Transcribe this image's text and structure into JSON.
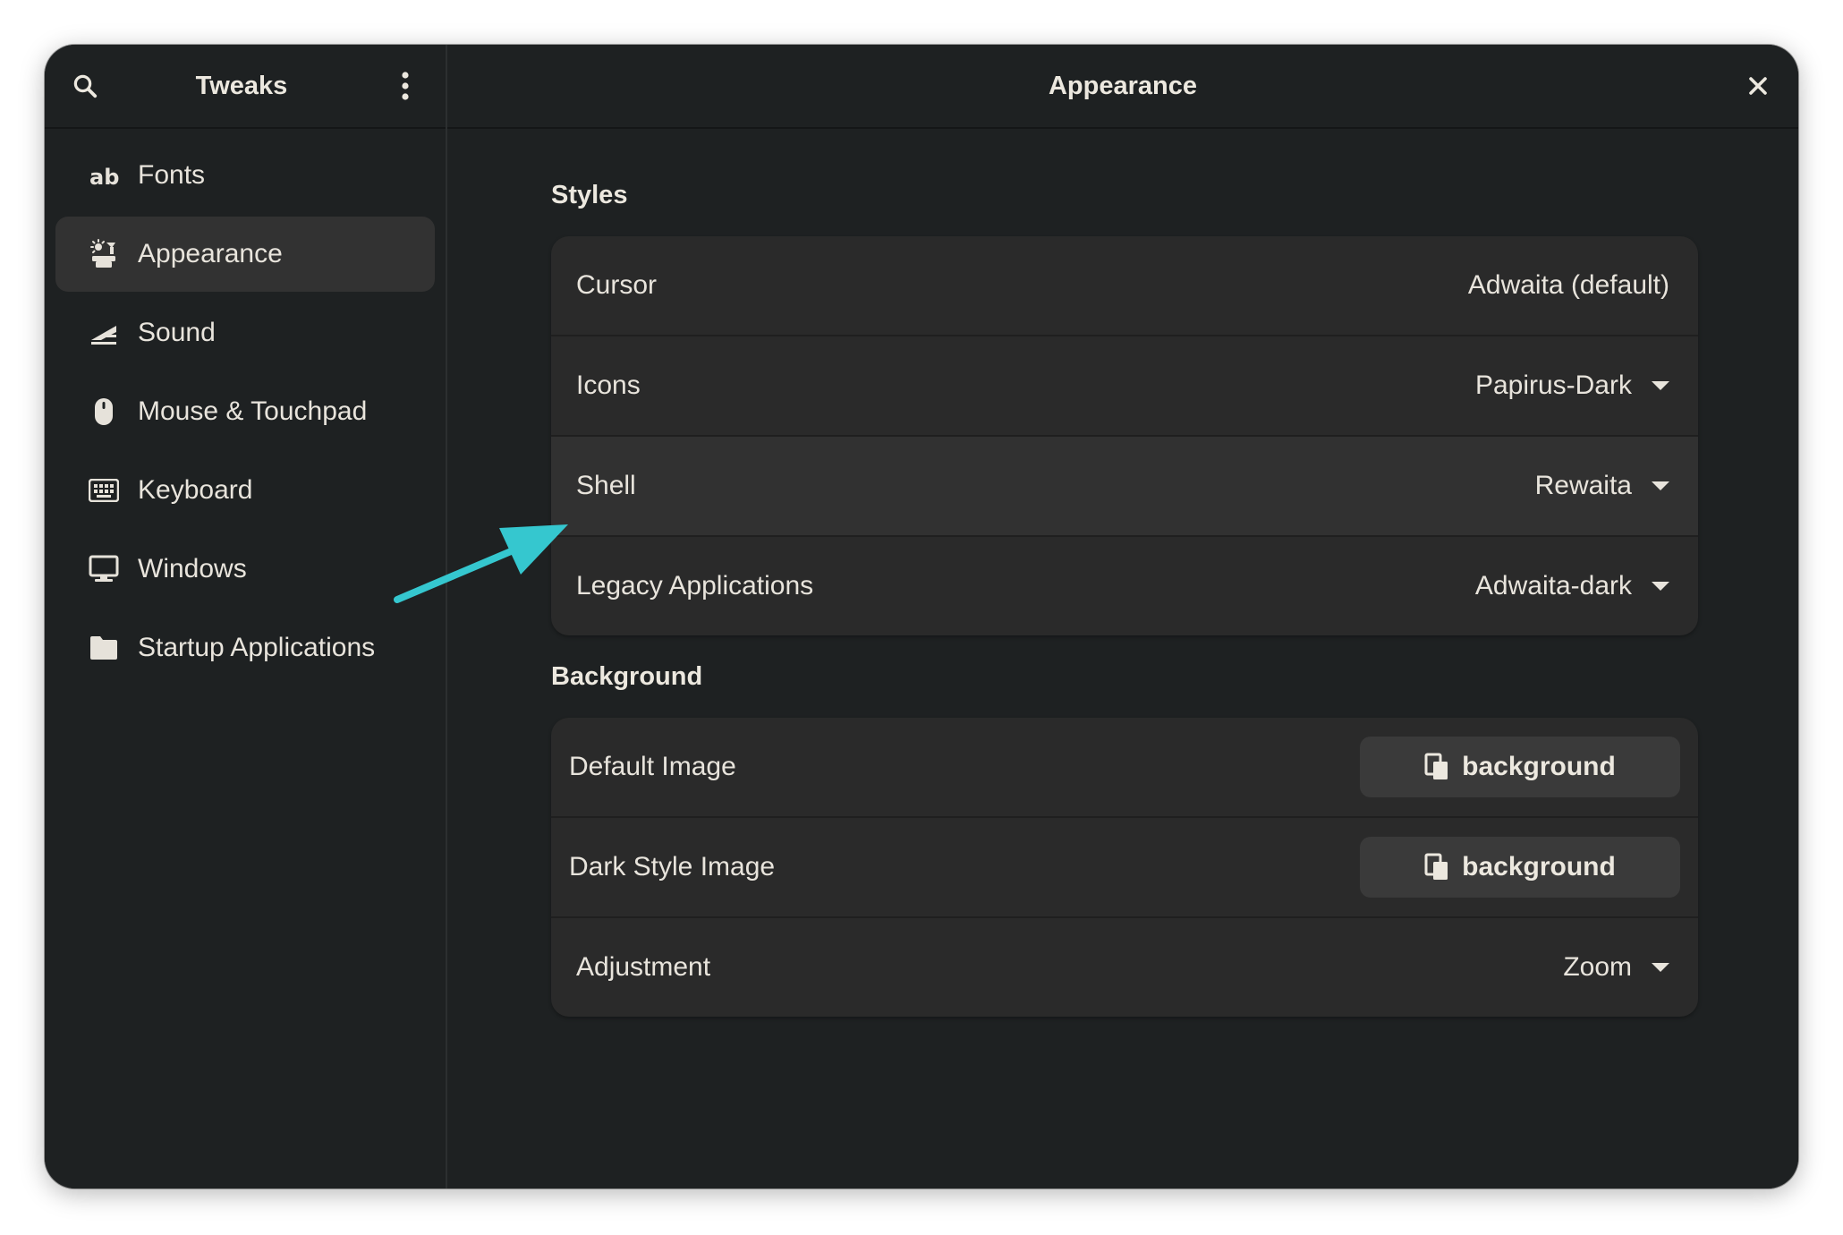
{
  "sidebar": {
    "title": "Tweaks",
    "search_icon": "search-icon",
    "menu_icon": "kebab-menu-icon",
    "items": [
      {
        "label": "Fonts",
        "icon": "fonts-icon",
        "active": false
      },
      {
        "label": "Appearance",
        "icon": "appearance-icon",
        "active": true
      },
      {
        "label": "Sound",
        "icon": "sound-icon",
        "active": false
      },
      {
        "label": "Mouse & Touchpad",
        "icon": "mouse-icon",
        "active": false
      },
      {
        "label": "Keyboard",
        "icon": "keyboard-icon",
        "active": false
      },
      {
        "label": "Windows",
        "icon": "monitor-icon",
        "active": false
      },
      {
        "label": "Startup Applications",
        "icon": "folder-icon",
        "active": false
      }
    ]
  },
  "content": {
    "title": "Appearance",
    "close_icon": "close-icon",
    "styles": {
      "title": "Styles",
      "rows": [
        {
          "label": "Cursor",
          "value": "Adwaita (default)",
          "dropdown": false
        },
        {
          "label": "Icons",
          "value": "Papirus-Dark",
          "dropdown": true
        },
        {
          "label": "Shell",
          "value": "Rewaita",
          "dropdown": true
        },
        {
          "label": "Legacy Applications",
          "value": "Adwaita-dark",
          "dropdown": true
        }
      ]
    },
    "background": {
      "title": "Background",
      "default_image": {
        "label": "Default Image",
        "button": "background"
      },
      "dark_style_image": {
        "label": "Dark Style Image",
        "button": "background"
      },
      "adjustment": {
        "label": "Adjustment",
        "value": "Zoom"
      }
    }
  },
  "colors": {
    "window_bg": "#1e2122",
    "row_bg": "#2a2a2a",
    "active_item_bg": "#323232",
    "text": "#e8e4dc",
    "annotation_arrow": "#35c7cf"
  }
}
